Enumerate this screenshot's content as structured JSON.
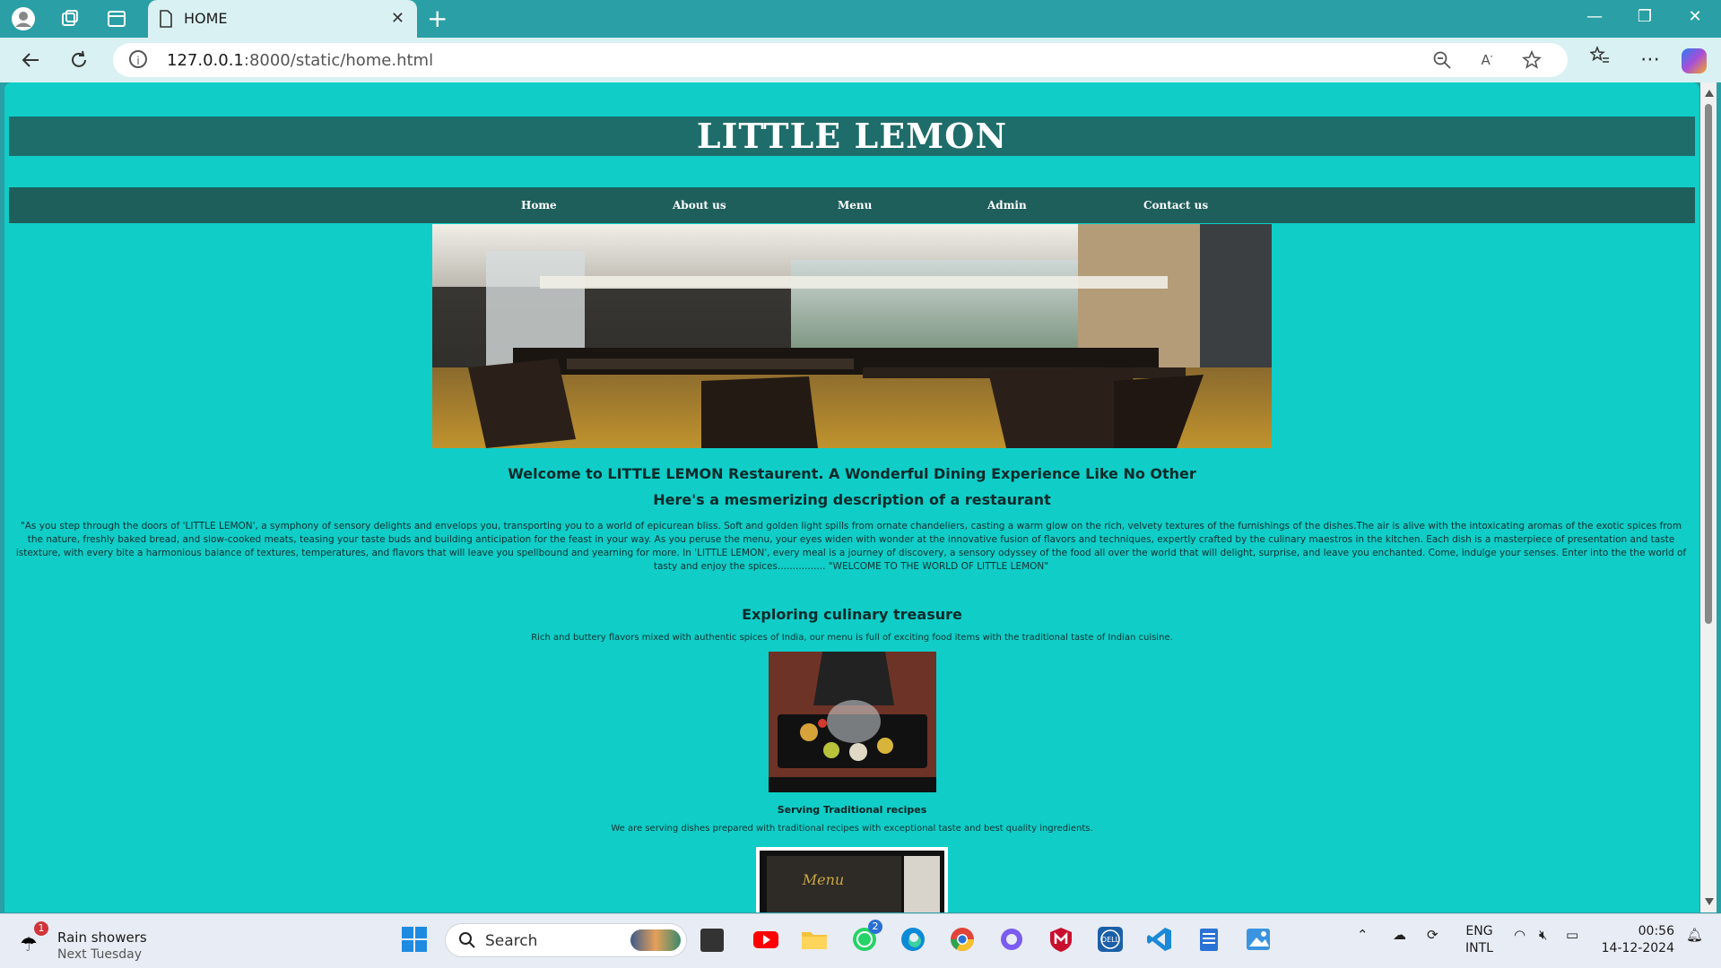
{
  "browser": {
    "tab_title": "HOME",
    "url_host": "127.0.0.1",
    "url_rest": ":8000/static/home.html"
  },
  "page": {
    "site_title": "LITTLE LEMON",
    "nav": [
      "Home",
      "About us",
      "Menu",
      "Admin",
      "Contact us"
    ],
    "welcome": "Welcome to LITTLE LEMON Restaurent. A Wonderful Dining Experience Like No Other",
    "subheading": "Here's a mesmerizing description of a restaurant",
    "description": "\"As you step through the doors of 'LITTLE LEMON', a symphony of sensory delights and envelops you, transporting you to a world of epicurean bliss. Soft and golden light spills from ornate chandeliers, casting a warm glow on the rich, velvety textures of the furnishings of the dishes.The air is alive with the intoxicating aromas of the exotic spices from the nature, freshly baked bread, and slow-cooked meats, teasing your taste buds and building anticipation for the feast in your way. As you peruse the menu, your eyes widen with wonder at the innovative fusion of flavors and techniques, expertly crafted by the culinary maestros in the kitchen. Each dish is a masterpiece of presentation and taste istexture, with every bite a harmonious balance of textures, temperatures, and flavors that will leave you spellbound and yearning for more. In 'LITTLE LEMON', every meal is a journey of discovery, a sensory odyssey of the food all over the world that will delight, surprise, and leave you enchanted. Come, indulge your senses. Enter into the the world of tasty and enjoy the spices................ \"WELCOME TO THE WORLD OF LITTLE LEMON\"",
    "section_title": "Exploring culinary treasure",
    "section_text": "Rich and buttery flavors mixed with authentic spices of India, our menu is full of exciting food items with the traditional taste of Indian cuisine.",
    "serving_title": "Serving Traditional recipes",
    "serving_text": "We are serving dishes prepared with traditional recipes with exceptional taste and best quality ingredients.",
    "menu_image_text": "Menu"
  },
  "taskbar": {
    "weather_badge": "1",
    "weather_line1": "Rain showers",
    "weather_line2": "Next Tuesday",
    "search_label": "Search",
    "whatsapp_badge": "2",
    "lang_line1": "ENG",
    "lang_line2": "INTL",
    "time": "00:56",
    "date": "14-12-2024"
  }
}
